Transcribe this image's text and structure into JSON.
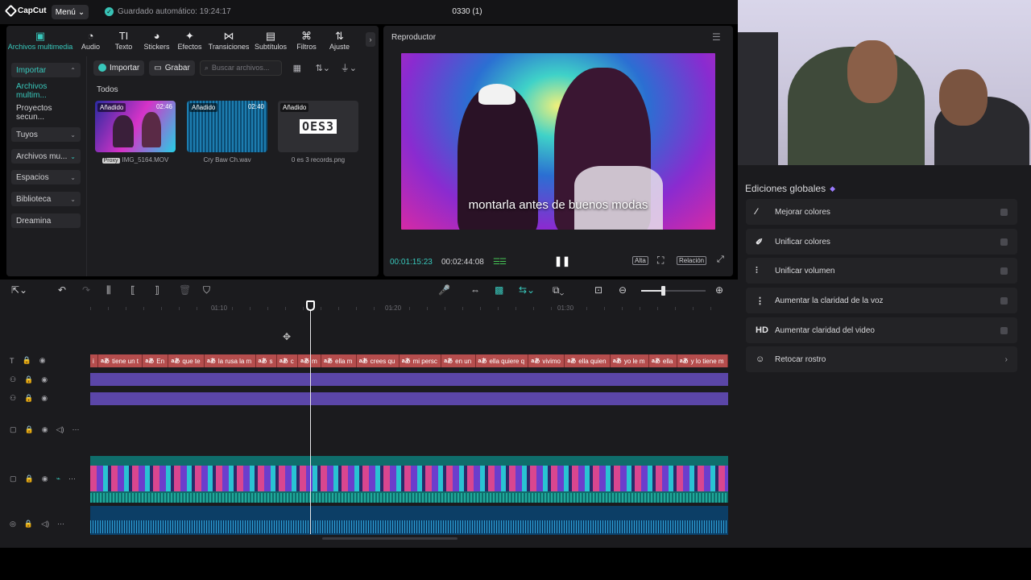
{
  "topbar": {
    "app_name": "CapCut",
    "menu_label": "Menú",
    "autosave": "Guardado automático: 19:24:17",
    "doc_title": "0330 (1)"
  },
  "media_tabs": [
    {
      "label": "Archivos multimedia",
      "icon": "media-icon"
    },
    {
      "label": "Audio",
      "icon": "audio-icon"
    },
    {
      "label": "Texto",
      "icon": "text-icon"
    },
    {
      "label": "Stickers",
      "icon": "stickers-icon"
    },
    {
      "label": "Efectos",
      "icon": "effects-icon"
    },
    {
      "label": "Transiciones",
      "icon": "transitions-icon"
    },
    {
      "label": "Subtítulos",
      "icon": "subtitles-icon"
    },
    {
      "label": "Filtros",
      "icon": "filters-icon"
    },
    {
      "label": "Ajuste",
      "icon": "adjust-icon"
    }
  ],
  "media_sidebar": [
    {
      "label": "Importar"
    },
    {
      "label": "Archivos multim..."
    },
    {
      "label": "Proyectos secun..."
    },
    {
      "label": "Tuyos"
    },
    {
      "label": "Archivos mu..."
    },
    {
      "label": "Espacios"
    },
    {
      "label": "Biblioteca"
    },
    {
      "label": "Dreamina"
    }
  ],
  "media_toolbar": {
    "import_label": "Importar",
    "record_label": "Grabar",
    "search_placeholder": "Buscar archivos..."
  },
  "section_title": "Todos",
  "media_items": [
    {
      "name": "IMG_5164.MOV",
      "badge": "Añadido",
      "duration": "02:46",
      "proxy": "Proxy"
    },
    {
      "name": "Cry Baw Ch.wav",
      "badge": "Añadido",
      "duration": "02:40"
    },
    {
      "name": "0 es 3 records.png",
      "badge": "Añadido",
      "logo": "OES3"
    }
  ],
  "player": {
    "title": "Reproductor",
    "caption": "montarla antes de buenos modas",
    "time_current": "00:01:15:23",
    "time_total": "00:02:44:08",
    "quality": "Alta",
    "ratio": "Relación"
  },
  "timeline": {
    "ruler_labels": [
      "01:10",
      "01:20",
      "01:30"
    ],
    "text_clips": [
      "i",
      "tiene un t",
      "En",
      "que te",
      "la rusa la m",
      "s",
      "c",
      "m",
      "ella m",
      "crees qu",
      "mi persc",
      "en un",
      "ella quiere q",
      "vivimo",
      "ella quien",
      "yo le m",
      "ella",
      "y lo tiene m"
    ]
  },
  "right_panel": {
    "title": "Ediciones globales",
    "items": [
      {
        "label": "Mejorar colores",
        "icon": "magic-wand-icon",
        "glyph": "⁄"
      },
      {
        "label": "Unificar colores",
        "icon": "color-brush-icon",
        "glyph": "✐"
      },
      {
        "label": "Unificar volumen",
        "icon": "sliders-icon",
        "glyph": "⫶"
      },
      {
        "label": "Aumentar la claridad de la voz",
        "icon": "voice-wave-icon",
        "glyph": "⋮"
      },
      {
        "label": "Aumentar claridad del video",
        "icon": "hd-icon",
        "glyph": "HD"
      },
      {
        "label": "Retocar rostro",
        "icon": "face-retouch-icon",
        "glyph": "☺"
      }
    ]
  }
}
